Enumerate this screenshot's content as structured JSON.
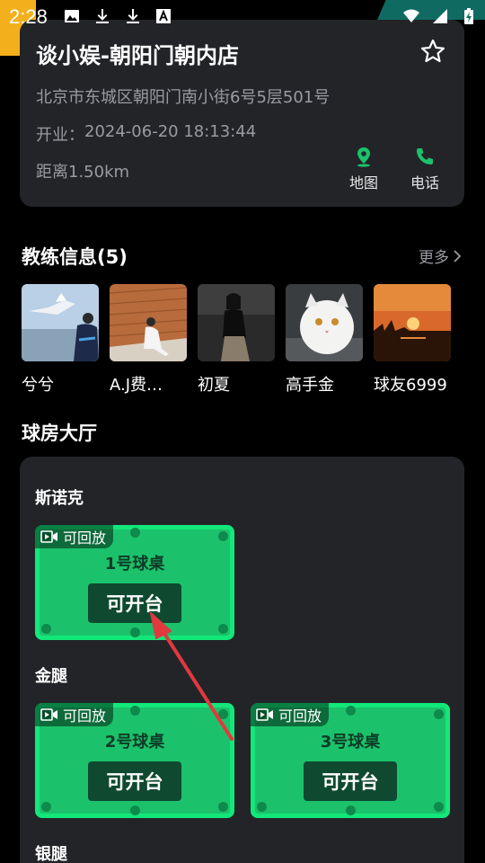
{
  "status_bar": {
    "time": "2:28",
    "left_icons": [
      "image-icon",
      "download-icon",
      "download-icon",
      "font-icon"
    ],
    "right_icons": [
      "wifi-icon",
      "signal-icon",
      "battery-charging-icon"
    ]
  },
  "shop": {
    "name": "谈小娱-朝阳门朝内店",
    "address": "北京市东城区朝阳门南小街6号5层501号",
    "open_label": "开业：",
    "open_time": "2024-06-20 18:13:44",
    "distance": "距离1.50km",
    "map_label": "地图",
    "phone_label": "电话"
  },
  "coaches": {
    "title": "教练信息(5)",
    "more_label": "更多",
    "items": [
      {
        "name": "兮兮"
      },
      {
        "name": "A.J费…"
      },
      {
        "name": "初夏"
      },
      {
        "name": "高手金"
      },
      {
        "name": "球友6999"
      }
    ]
  },
  "hall": {
    "title": "球房大厅",
    "groups": [
      {
        "label": "斯诺克",
        "tables": [
          {
            "replay": "可回放",
            "name": "1号球桌",
            "action": "可开台"
          }
        ]
      },
      {
        "label": "金腿",
        "tables": [
          {
            "replay": "可回放",
            "name": "2号球桌",
            "action": "可开台"
          },
          {
            "replay": "可回放",
            "name": "3号球桌",
            "action": "可开台"
          }
        ]
      },
      {
        "label": "银腿",
        "tables": []
      }
    ]
  },
  "colors": {
    "background": "#000000",
    "card": "#232428",
    "accent_green": "#1bc26b",
    "table_border": "#12e87a",
    "button_dark": "#0f4a30",
    "arrow_red": "#e0393e"
  }
}
